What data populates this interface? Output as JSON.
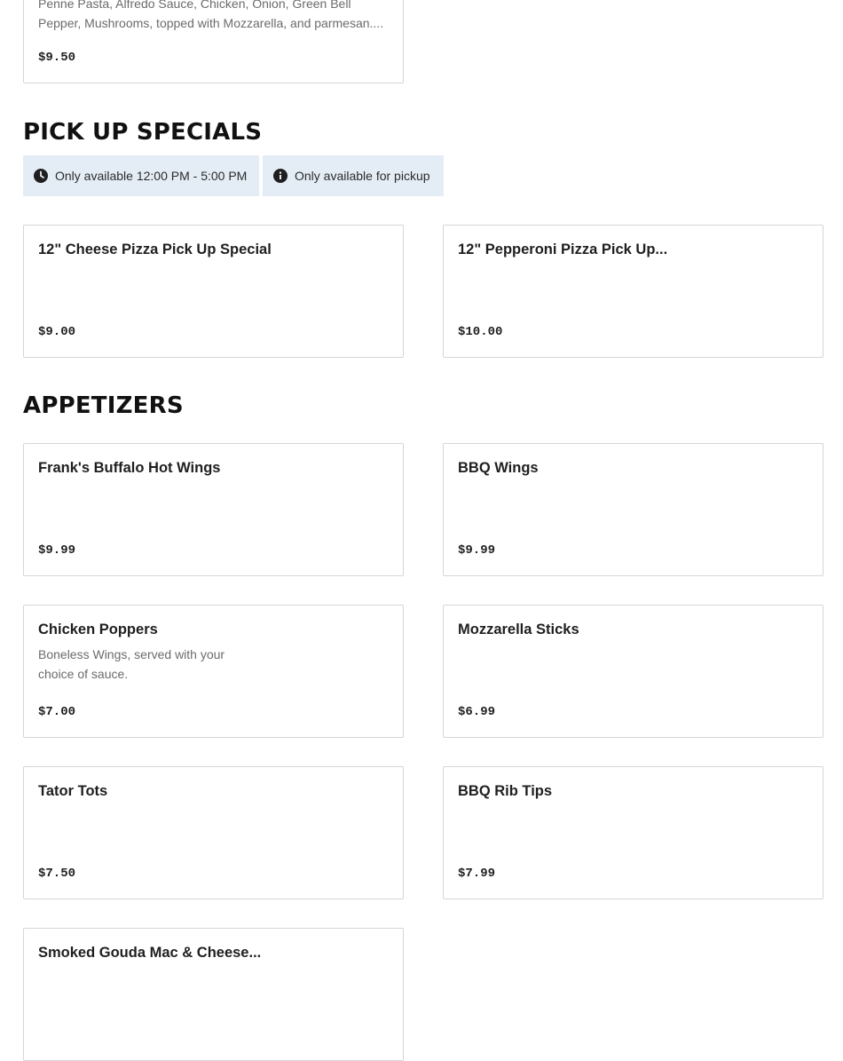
{
  "top_card": {
    "description": "Penne Pasta, Alfredo Sauce, Chicken, Onion, Green Bell Pepper, Mushrooms, topped with Mozzarella, and parmesan....",
    "price": "$9.50"
  },
  "pickup_specials": {
    "title": "PICK UP SPECIALS",
    "tags": [
      {
        "icon": "clock-icon",
        "label": "Only available 12:00 PM - 5:00 PM"
      },
      {
        "icon": "info-icon",
        "label": "Only available for pickup"
      }
    ],
    "items": [
      {
        "name": "12\" Cheese Pizza Pick Up Special",
        "price": "$9.00"
      },
      {
        "name": "12\" Pepperoni Pizza Pick Up...",
        "price": "$10.00"
      }
    ]
  },
  "appetizers": {
    "title": "APPETIZERS",
    "items": [
      {
        "name": "Frank's Buffalo Hot Wings",
        "price": "$9.99"
      },
      {
        "name": "BBQ Wings",
        "price": "$9.99"
      },
      {
        "name": "Chicken Poppers",
        "description": "Boneless Wings, served with your choice of sauce.",
        "price": "$7.00"
      },
      {
        "name": "Mozzarella Sticks",
        "price": "$6.99"
      },
      {
        "name": "Tator Tots",
        "price": "$7.50"
      },
      {
        "name": "BBQ Rib Tips",
        "price": "$7.99"
      },
      {
        "name": "Smoked Gouda Mac & Cheese..."
      }
    ]
  }
}
